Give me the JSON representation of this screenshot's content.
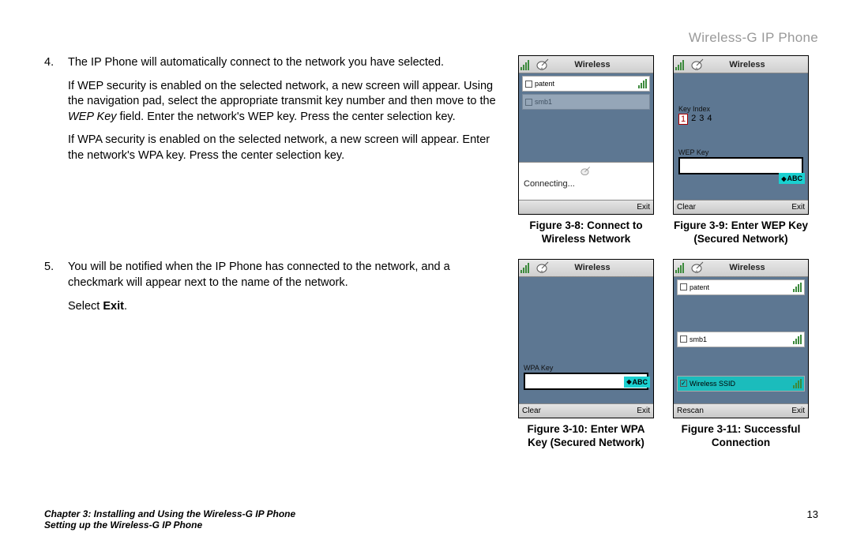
{
  "product_title": "Wireless-G IP Phone",
  "step4": {
    "num": "4.",
    "p1": "The IP Phone will automatically connect to the network you have selected.",
    "p2a": "If WEP security is enabled on the selected network, a new screen will appear. Using the navigation pad, select the appropriate transmit key number and then move to the ",
    "p2b_i": "WEP Key",
    "p2c": " field. Enter the network's WEP key. Press the center selection key.",
    "p3": "If WPA security is enabled on the selected network, a new screen will appear. Enter the network's WPA key. Press the center selection key."
  },
  "step5": {
    "num": "5.",
    "p1": "You will be notified when the IP Phone has connected to the network, and a checkmark will appear next to the name of the network.",
    "p2a": "Select ",
    "p2b_b": "Exit",
    "p2c": "."
  },
  "phone_title": "Wireless",
  "net": {
    "patent": "patent",
    "smb1": "smb1",
    "wssid": "Wireless SSID"
  },
  "connecting": "Connecting...",
  "labels": {
    "key_index": "Key Index",
    "wep_key": "WEP Key",
    "wpa_key": "WPA Key"
  },
  "key_index_values": [
    "1",
    "2",
    "3",
    "4"
  ],
  "abc": "ABC",
  "softkeys": {
    "exit": "Exit",
    "clear": "Clear",
    "rescan": "Rescan"
  },
  "captions": {
    "f38": "Figure 3-8: Connect to Wireless Network",
    "f39": "Figure 3-9: Enter WEP Key (Secured Network)",
    "f310": "Figure 3-10: Enter WPA Key (Secured Network)",
    "f311": "Figure 3-11: Successful Connection"
  },
  "footer": {
    "chapter": "Chapter 3: Installing and Using the Wireless-G IP Phone",
    "section": "Setting up the Wireless-G IP Phone",
    "page": "13"
  }
}
